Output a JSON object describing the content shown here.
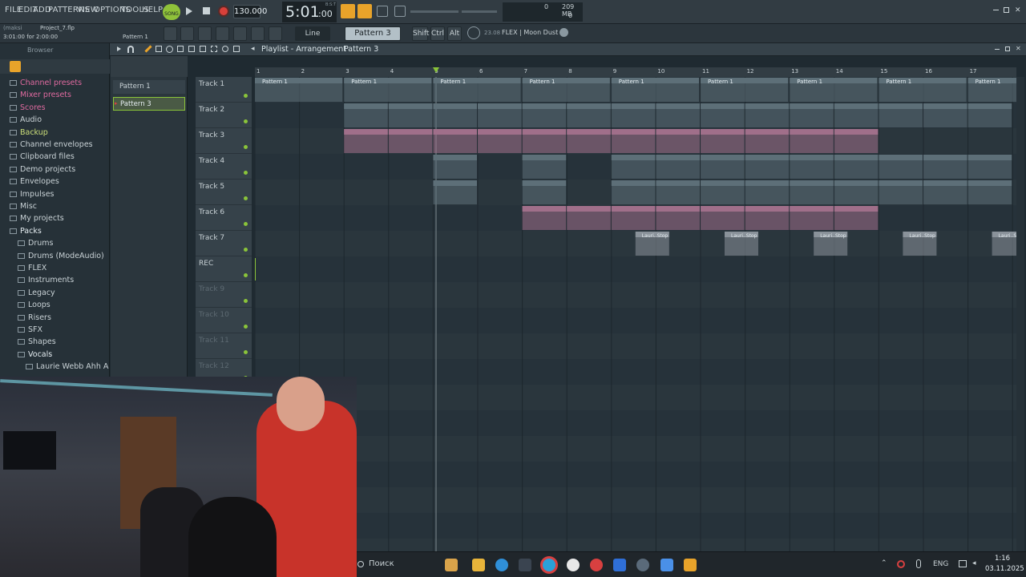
{
  "menu": [
    "FILE",
    "EDIT",
    "ADD",
    "PATTERNS",
    "VIEW",
    "OPTIONS",
    "TOOLS",
    "HELP"
  ],
  "transport": {
    "song_label": "SONG",
    "tempo": "130.000",
    "time": "5:01",
    "time_sub": ":00",
    "time_unit": "B:S:T",
    "cpu_value": "0",
    "ram_value": "209 MB",
    "ram_sub": "0"
  },
  "project": {
    "author": "(maksi",
    "file": "Project_7.flp",
    "position": "3:01:00 for 2:00:00",
    "current_pattern": "Pattern 1"
  },
  "toolbar2": {
    "snap": "Line",
    "pattern_selector": "Pattern 3",
    "mod_keys": [
      "Shift",
      "Ctrl",
      "Alt"
    ],
    "plugin_hint": "23.08",
    "plugin_name": "FLEX | Moon Dust"
  },
  "browser": {
    "title": "Browser",
    "items": [
      {
        "label": "Channel presets",
        "color": "#e06aa0",
        "indent": 0
      },
      {
        "label": "Mixer presets",
        "color": "#e06aa0",
        "indent": 0
      },
      {
        "label": "Scores",
        "color": "#e06aa0",
        "indent": 0
      },
      {
        "label": "Audio",
        "color": "#c9d2d6",
        "indent": 0
      },
      {
        "label": "Backup",
        "color": "#cde07a",
        "indent": 0
      },
      {
        "label": "Channel envelopes",
        "color": "#c9d2d6",
        "indent": 0
      },
      {
        "label": "Clipboard files",
        "color": "#c9d2d6",
        "indent": 0
      },
      {
        "label": "Demo projects",
        "color": "#c9d2d6",
        "indent": 0
      },
      {
        "label": "Envelopes",
        "color": "#c9d2d6",
        "indent": 0
      },
      {
        "label": "Impulses",
        "color": "#c9d2d6",
        "indent": 0
      },
      {
        "label": "Misc",
        "color": "#c9d2d6",
        "indent": 0
      },
      {
        "label": "My projects",
        "color": "#c9d2d6",
        "indent": 0
      },
      {
        "label": "Packs",
        "color": "#e6eef2",
        "indent": 0
      },
      {
        "label": "Drums",
        "color": "#c9d2d6",
        "indent": 1
      },
      {
        "label": "Drums (ModeAudio)",
        "color": "#c9d2d6",
        "indent": 1
      },
      {
        "label": "FLEX",
        "color": "#c9d2d6",
        "indent": 1
      },
      {
        "label": "Instruments",
        "color": "#c9d2d6",
        "indent": 1
      },
      {
        "label": "Legacy",
        "color": "#c9d2d6",
        "indent": 1
      },
      {
        "label": "Loops",
        "color": "#c9d2d6",
        "indent": 1
      },
      {
        "label": "Risers",
        "color": "#c9d2d6",
        "indent": 1
      },
      {
        "label": "SFX",
        "color": "#c9d2d6",
        "indent": 1
      },
      {
        "label": "Shapes",
        "color": "#c9d2d6",
        "indent": 1
      },
      {
        "label": "Vocals",
        "color": "#e6eef2",
        "indent": 1
      },
      {
        "label": "Laurie Webb Ahh A",
        "color": "#c9d2d6",
        "indent": 2
      }
    ]
  },
  "picker": {
    "patterns": [
      {
        "label": "Pattern 1",
        "selected": false
      },
      {
        "label": "Pattern 3",
        "selected": true
      }
    ]
  },
  "playlist": {
    "title": "Playlist - Arrangement",
    "pattern": "Pattern 3",
    "bars": [
      "1",
      "2",
      "3",
      "4",
      "5",
      "6",
      "7",
      "8",
      "9",
      "10",
      "11",
      "12",
      "13",
      "14",
      "15",
      "16",
      "17"
    ],
    "tracks": [
      "Track 1",
      "Track 2",
      "Track 3",
      "Track 4",
      "Track 5",
      "Track 6",
      "Track 7",
      "REC",
      "Track 9",
      "Track 10",
      "Track 11",
      "Track 12"
    ],
    "track1_clip": "Pattern 1",
    "track7_clip": "Lauri..Stop",
    "colors": {
      "pattern": "#5d6f78",
      "pink": "#a06f8a",
      "audio": "#8a929a",
      "bg": "#28343b"
    }
  },
  "taskbar": {
    "search": "Поиск",
    "lang": "ENG",
    "time": "1:16",
    "date": "03.11.2025"
  }
}
